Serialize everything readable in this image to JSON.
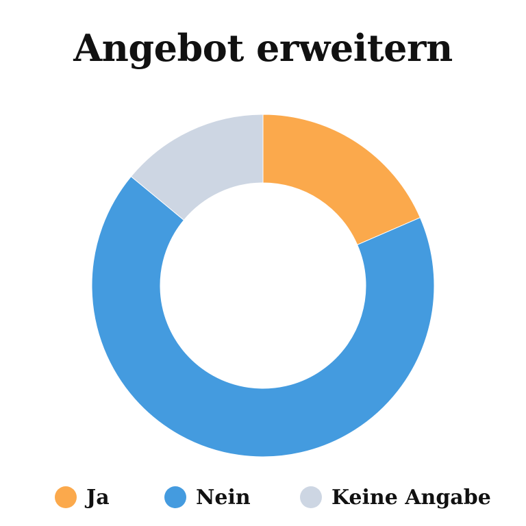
{
  "chart_data": {
    "type": "pie",
    "variant": "donut",
    "title": "Angebot erweitern",
    "categories": [
      "Ja",
      "Nein",
      "Keine Angabe"
    ],
    "values": [
      18.5,
      67.5,
      14.0
    ],
    "colors": [
      "#FBA94C",
      "#449BDF",
      "#CDD6E3"
    ],
    "start_angle_deg": 0,
    "direction": "clockwise",
    "legend_position": "bottom"
  }
}
